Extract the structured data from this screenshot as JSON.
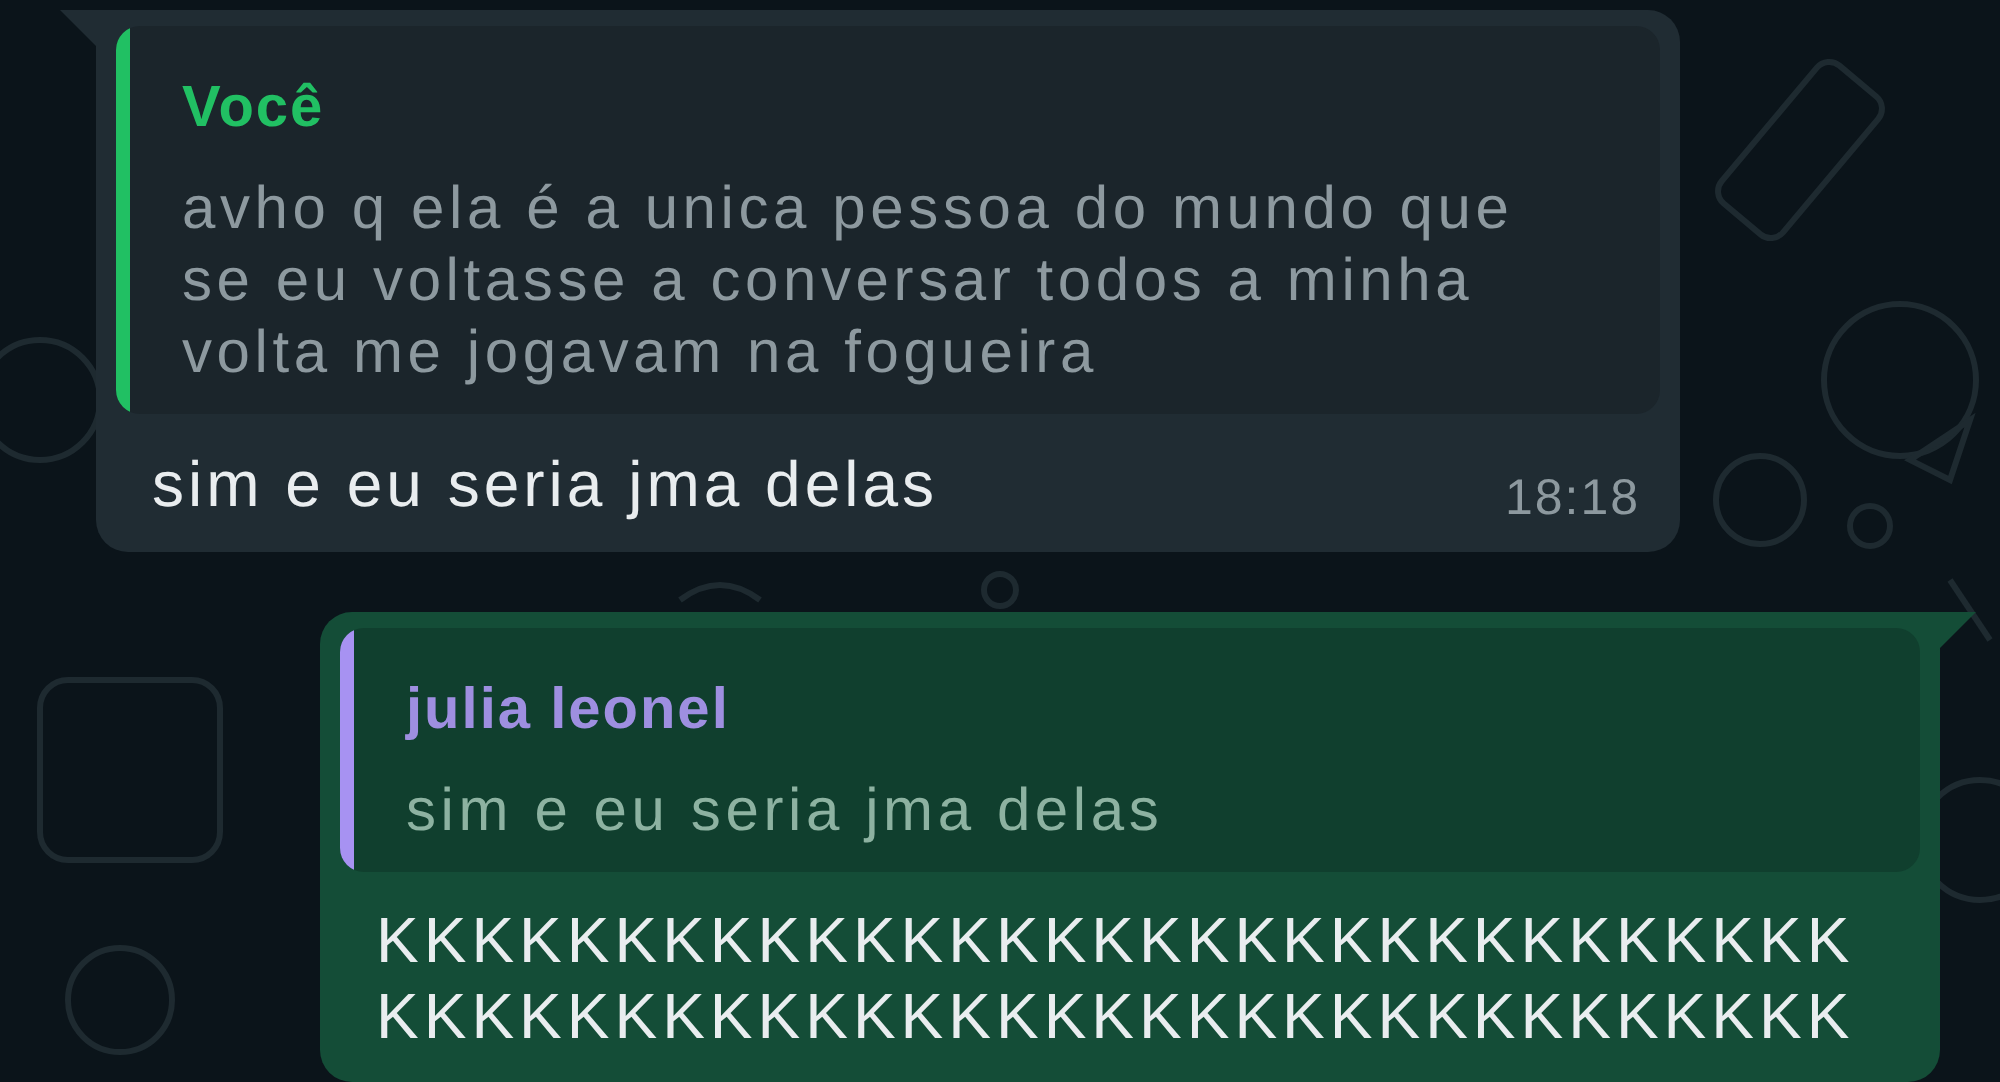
{
  "messages": [
    {
      "kind": "incoming",
      "quote": {
        "author": "Você",
        "kind": "self",
        "text": "avho q ela é a unica pessoa do mundo que se eu voltasse a conversar todos a minha volta me jogavam na fogueira"
      },
      "text": "sim e eu seria jma delas",
      "time": "18:18"
    },
    {
      "kind": "outgoing",
      "quote": {
        "author": "julia leonel",
        "kind": "contact",
        "text": "sim e eu seria jma delas"
      },
      "text": "KKKKKKKKKKKKKKKKKKKKKKKKKKKKKKKKKKKKKKKKKKKKKKKKKKKKKKKKKKKKKK"
    }
  ]
}
